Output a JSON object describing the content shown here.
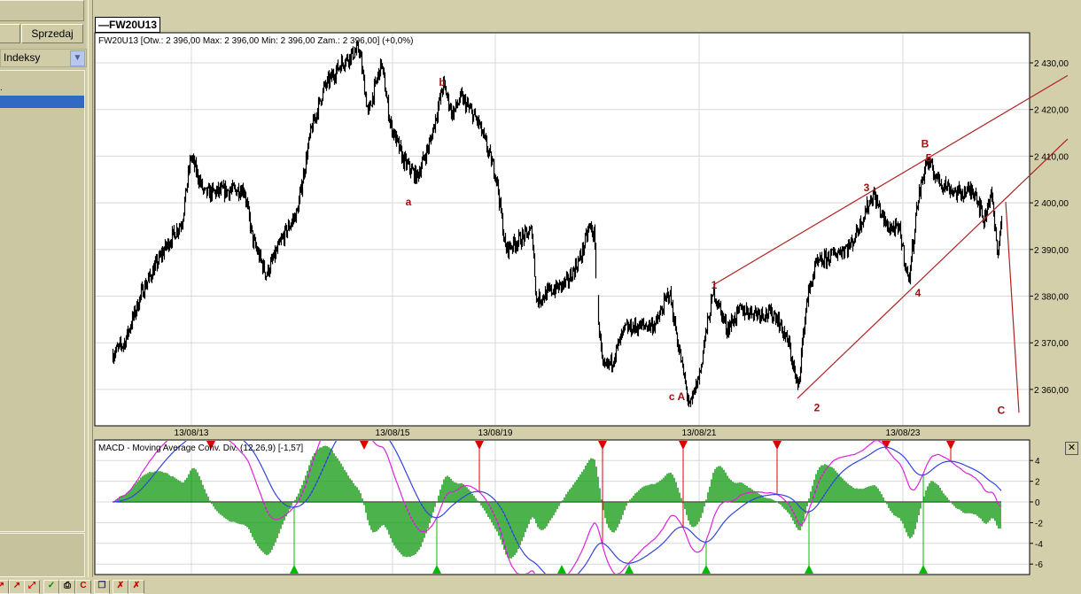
{
  "left_panel": {
    "sell_button": "Sprzedaj",
    "category_select": "Indeksy",
    "list_marker": "."
  },
  "chart": {
    "symbol_tab": "FW20U13",
    "info_line": "FW20U13 [Otw.: 2 396,00  Max: 2 396,00  Min: 2 396,00  Zam.: 2 396,00] (+0,0%)",
    "macd_title": "MACD - Moving Average Conv. Div. (12,26,9) [-1,57]"
  },
  "colors": {
    "price": "#000000",
    "annotation": "#a01010",
    "macd": "#dd22dd",
    "signal": "#3344dd",
    "histogram": "#119911",
    "buy": "#00bb00",
    "sell": "#dd0000"
  },
  "chart_data": [
    {
      "type": "ohlc",
      "title": "FW20U13",
      "ylim": [
        2353,
        2437
      ],
      "y_ticks": [
        "2 360,00",
        "2 370,00",
        "2 380,00",
        "2 390,00",
        "2 400,00",
        "2 410,00",
        "2 420,00",
        "2 430,00"
      ],
      "y_tick_values": [
        2360,
        2370,
        2380,
        2390,
        2400,
        2410,
        2420,
        2430
      ],
      "x_ticks": [
        {
          "label": "13/08/13",
          "bar": 89
        },
        {
          "label": "13/08/15",
          "bar": 316
        },
        {
          "label": "13/08/19",
          "bar": 432
        },
        {
          "label": "13/08/21",
          "bar": 662
        },
        {
          "label": "13/08/23",
          "bar": 892
        }
      ],
      "bars_total": 1035,
      "price_path": [
        [
          0,
          2367.6
        ],
        [
          13,
          2370
        ],
        [
          33,
          2381
        ],
        [
          58,
          2390
        ],
        [
          78,
          2396
        ],
        [
          88,
          2410
        ],
        [
          103,
          2402
        ],
        [
          148,
          2403
        ],
        [
          158,
          2392
        ],
        [
          173,
          2384.6
        ],
        [
          193,
          2393
        ],
        [
          208,
          2398
        ],
        [
          223,
          2415
        ],
        [
          238,
          2424.5
        ],
        [
          258,
          2430
        ],
        [
          278,
          2433
        ],
        [
          288,
          2419
        ],
        [
          303,
          2430
        ],
        [
          313,
          2417
        ],
        [
          328,
          2409
        ],
        [
          343,
          2405.5
        ],
        [
          358,
          2413
        ],
        [
          373,
          2425.5
        ],
        [
          383,
          2419
        ],
        [
          393,
          2422.6
        ],
        [
          413,
          2417
        ],
        [
          433,
          2405.5
        ],
        [
          443,
          2390
        ],
        [
          458,
          2392
        ],
        [
          473,
          2394
        ],
        [
          478,
          2379
        ],
        [
          493,
          2381
        ],
        [
          513,
          2383
        ],
        [
          528,
          2388.4
        ],
        [
          538,
          2395
        ],
        [
          543,
          2393
        ],
        [
          548,
          2375
        ],
        [
          553,
          2364
        ],
        [
          563,
          2366
        ],
        [
          578,
          2373
        ],
        [
          613,
          2374
        ],
        [
          628,
          2381
        ],
        [
          638,
          2369.5
        ],
        [
          651,
          2356
        ],
        [
          663,
          2364
        ],
        [
          668,
          2371
        ],
        [
          678,
          2381
        ],
        [
          693,
          2373
        ],
        [
          708,
          2377
        ],
        [
          748,
          2376
        ],
        [
          763,
          2369.5
        ],
        [
          773,
          2360
        ],
        [
          783,
          2379
        ],
        [
          793,
          2386.5
        ],
        [
          808,
          2388.4
        ],
        [
          833,
          2391
        ],
        [
          858,
          2402
        ],
        [
          873,
          2395
        ],
        [
          888,
          2394
        ],
        [
          898,
          2383
        ],
        [
          908,
          2400
        ],
        [
          918,
          2409
        ],
        [
          933,
          2404.6
        ],
        [
          953,
          2402
        ],
        [
          973,
          2402.7
        ],
        [
          983,
          2396
        ],
        [
          991,
          2402.7
        ],
        [
          998,
          2389.4
        ],
        [
          1003,
          2396
        ]
      ],
      "trendlines": [
        {
          "from": [
            678,
            2382.4
          ],
          "to": [
            1078,
            2427.3
          ]
        },
        {
          "from": [
            773,
            2358.1
          ],
          "to": [
            1078,
            2413.7
          ]
        },
        {
          "from": [
            1008,
            2400.2
          ],
          "to": [
            1023,
            2355
          ]
        }
      ],
      "wave_labels": [
        {
          "text": "a",
          "bar": 334,
          "price": 2400.2
        },
        {
          "text": "b",
          "bar": 372,
          "price": 2425.8
        },
        {
          "text": "c A",
          "bar": 637,
          "price": 2358.5
        },
        {
          "text": "1",
          "bar": 679,
          "price": 2382.4
        },
        {
          "text": "2",
          "bar": 795,
          "price": 2356.1
        },
        {
          "text": "3",
          "bar": 851,
          "price": 2403.2
        },
        {
          "text": "4",
          "bar": 909,
          "price": 2380.7
        },
        {
          "text": "B",
          "bar": 917,
          "price": 2412.6
        },
        {
          "text": "5",
          "bar": 921,
          "price": 2409.6
        },
        {
          "text": "C",
          "bar": 1003,
          "price": 2355.5
        }
      ]
    },
    {
      "type": "line",
      "title": "MACD - Moving Average Conv. Div. (12,26,9) [-1,57]",
      "params": [
        12,
        26,
        9
      ],
      "last_value": -1.57,
      "ylim": [
        -7,
        6
      ],
      "y_ticks": [
        "4",
        "2",
        "0",
        "-2",
        "-4",
        "-6"
      ],
      "y_tick_values": [
        4,
        2,
        0,
        -2,
        -4,
        -6
      ],
      "series": [
        {
          "name": "MACD"
        },
        {
          "name": "Signal"
        },
        {
          "name": "Histogram"
        }
      ]
    }
  ]
}
